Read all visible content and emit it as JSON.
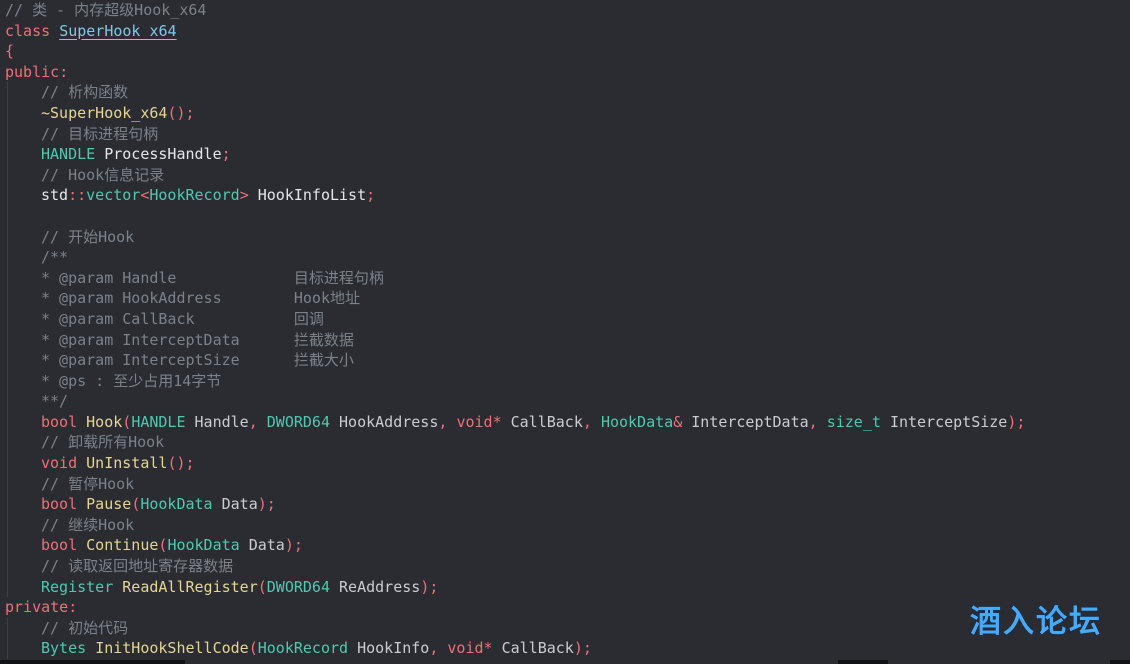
{
  "editor": {
    "lines": [
      {
        "indent": false,
        "tokens": [
          {
            "t": "comment",
            "v": "// 类 - 内存超级Hook_x64"
          }
        ]
      },
      {
        "indent": false,
        "tokens": [
          {
            "t": "keyword",
            "v": "class "
          },
          {
            "t": "class",
            "v": "SuperHook_x64"
          }
        ]
      },
      {
        "indent": false,
        "tokens": [
          {
            "t": "punct",
            "v": "{"
          }
        ]
      },
      {
        "indent": false,
        "tokens": [
          {
            "t": "keyword",
            "v": "public"
          },
          {
            "t": "punct",
            "v": ":"
          }
        ]
      },
      {
        "indent": true,
        "tokens": [
          {
            "t": "comment",
            "v": "// 析构函数"
          }
        ]
      },
      {
        "indent": true,
        "tokens": [
          {
            "t": "func",
            "v": "~SuperHook_x64"
          },
          {
            "t": "punct",
            "v": "();"
          }
        ]
      },
      {
        "indent": true,
        "tokens": [
          {
            "t": "comment",
            "v": "// 目标进程句柄"
          }
        ]
      },
      {
        "indent": true,
        "tokens": [
          {
            "t": "type",
            "v": "HANDLE "
          },
          {
            "t": "plain",
            "v": "ProcessHandle"
          },
          {
            "t": "punct",
            "v": ";"
          }
        ]
      },
      {
        "indent": true,
        "tokens": [
          {
            "t": "comment",
            "v": "// Hook信息记录"
          }
        ]
      },
      {
        "indent": true,
        "tokens": [
          {
            "t": "plain",
            "v": "std"
          },
          {
            "t": "punct",
            "v": "::"
          },
          {
            "t": "type",
            "v": "vector"
          },
          {
            "t": "punct",
            "v": "<"
          },
          {
            "t": "type",
            "v": "HookRecord"
          },
          {
            "t": "punct",
            "v": "> "
          },
          {
            "t": "plain",
            "v": "HookInfoList"
          },
          {
            "t": "punct",
            "v": ";"
          }
        ]
      },
      {
        "indent": true,
        "tokens": []
      },
      {
        "indent": true,
        "tokens": [
          {
            "t": "comment",
            "v": "// 开始Hook"
          }
        ]
      },
      {
        "indent": true,
        "tokens": [
          {
            "t": "doc",
            "v": "/**"
          }
        ]
      },
      {
        "indent": true,
        "tokens": [
          {
            "t": "doc",
            "v": "* @param Handle             "
          },
          {
            "t": "doctext",
            "v": "目标进程句柄"
          }
        ]
      },
      {
        "indent": true,
        "tokens": [
          {
            "t": "doc",
            "v": "* @param HookAddress        "
          },
          {
            "t": "doctext",
            "v": "Hook地址"
          }
        ]
      },
      {
        "indent": true,
        "tokens": [
          {
            "t": "doc",
            "v": "* @param CallBack           "
          },
          {
            "t": "doctext",
            "v": "回调"
          }
        ]
      },
      {
        "indent": true,
        "tokens": [
          {
            "t": "doc",
            "v": "* @param InterceptData      "
          },
          {
            "t": "doctext",
            "v": "拦截数据"
          }
        ]
      },
      {
        "indent": true,
        "tokens": [
          {
            "t": "doc",
            "v": "* @param InterceptSize      "
          },
          {
            "t": "doctext",
            "v": "拦截大小"
          }
        ]
      },
      {
        "indent": true,
        "tokens": [
          {
            "t": "doc",
            "v": "* @ps : 至少占用14字节"
          }
        ]
      },
      {
        "indent": true,
        "tokens": [
          {
            "t": "doc",
            "v": "**/"
          }
        ]
      },
      {
        "indent": true,
        "tokens": [
          {
            "t": "keyword",
            "v": "bool "
          },
          {
            "t": "func",
            "v": "Hook"
          },
          {
            "t": "punct",
            "v": "("
          },
          {
            "t": "type",
            "v": "HANDLE "
          },
          {
            "t": "param",
            "v": "Handle"
          },
          {
            "t": "punct",
            "v": ", "
          },
          {
            "t": "type",
            "v": "DWORD64 "
          },
          {
            "t": "param",
            "v": "HookAddress"
          },
          {
            "t": "punct",
            "v": ", "
          },
          {
            "t": "keyword",
            "v": "void"
          },
          {
            "t": "punct",
            "v": "* "
          },
          {
            "t": "param",
            "v": "CallBack"
          },
          {
            "t": "punct",
            "v": ", "
          },
          {
            "t": "type",
            "v": "HookData"
          },
          {
            "t": "punct",
            "v": "& "
          },
          {
            "t": "param",
            "v": "InterceptData"
          },
          {
            "t": "punct",
            "v": ", "
          },
          {
            "t": "type",
            "v": "size_t "
          },
          {
            "t": "param",
            "v": "InterceptSize"
          },
          {
            "t": "punct",
            "v": ");"
          }
        ]
      },
      {
        "indent": true,
        "tokens": [
          {
            "t": "comment",
            "v": "// 卸载所有Hook"
          }
        ]
      },
      {
        "indent": true,
        "tokens": [
          {
            "t": "keyword",
            "v": "void "
          },
          {
            "t": "func",
            "v": "UnInstall"
          },
          {
            "t": "punct",
            "v": "();"
          }
        ]
      },
      {
        "indent": true,
        "tokens": [
          {
            "t": "comment",
            "v": "// 暂停Hook"
          }
        ]
      },
      {
        "indent": true,
        "tokens": [
          {
            "t": "keyword",
            "v": "bool "
          },
          {
            "t": "func",
            "v": "Pause"
          },
          {
            "t": "punct",
            "v": "("
          },
          {
            "t": "type",
            "v": "HookData "
          },
          {
            "t": "param",
            "v": "Data"
          },
          {
            "t": "punct",
            "v": ");"
          }
        ]
      },
      {
        "indent": true,
        "tokens": [
          {
            "t": "comment",
            "v": "// 继续Hook"
          }
        ]
      },
      {
        "indent": true,
        "tokens": [
          {
            "t": "keyword",
            "v": "bool "
          },
          {
            "t": "func",
            "v": "Continue"
          },
          {
            "t": "punct",
            "v": "("
          },
          {
            "t": "type",
            "v": "HookData "
          },
          {
            "t": "param",
            "v": "Data"
          },
          {
            "t": "punct",
            "v": ");"
          }
        ]
      },
      {
        "indent": true,
        "tokens": [
          {
            "t": "comment",
            "v": "// 读取返回地址寄存器数据"
          }
        ]
      },
      {
        "indent": true,
        "tokens": [
          {
            "t": "type",
            "v": "Register "
          },
          {
            "t": "func",
            "v": "ReadAllRegister"
          },
          {
            "t": "punct",
            "v": "("
          },
          {
            "t": "type",
            "v": "DWORD64 "
          },
          {
            "t": "param",
            "v": "ReAddress"
          },
          {
            "t": "punct",
            "v": ");"
          }
        ]
      },
      {
        "indent": false,
        "tokens": [
          {
            "t": "keyword",
            "v": "private"
          },
          {
            "t": "punct",
            "v": ":"
          }
        ]
      },
      {
        "indent": true,
        "tokens": [
          {
            "t": "comment",
            "v": "// 初始代码"
          }
        ]
      },
      {
        "indent": true,
        "tokens": [
          {
            "t": "type",
            "v": "Bytes "
          },
          {
            "t": "func",
            "v": "InitHookShellCode"
          },
          {
            "t": "punct",
            "v": "("
          },
          {
            "t": "type",
            "v": "HookRecord "
          },
          {
            "t": "param",
            "v": "HookInfo"
          },
          {
            "t": "punct",
            "v": ", "
          },
          {
            "t": "keyword",
            "v": "void"
          },
          {
            "t": "punct",
            "v": "* "
          },
          {
            "t": "param",
            "v": "CallBack"
          },
          {
            "t": "punct",
            "v": ");"
          }
        ]
      }
    ]
  },
  "watermark": {
    "text": "酒入论坛"
  },
  "colors": {
    "background": "#2a2c31",
    "comment": "#7b818b",
    "keyword": "#ef6f78",
    "type": "#4ec9b0",
    "function": "#e5d594",
    "class": "#7ec8e3",
    "watermark": "#4aa9f3"
  }
}
